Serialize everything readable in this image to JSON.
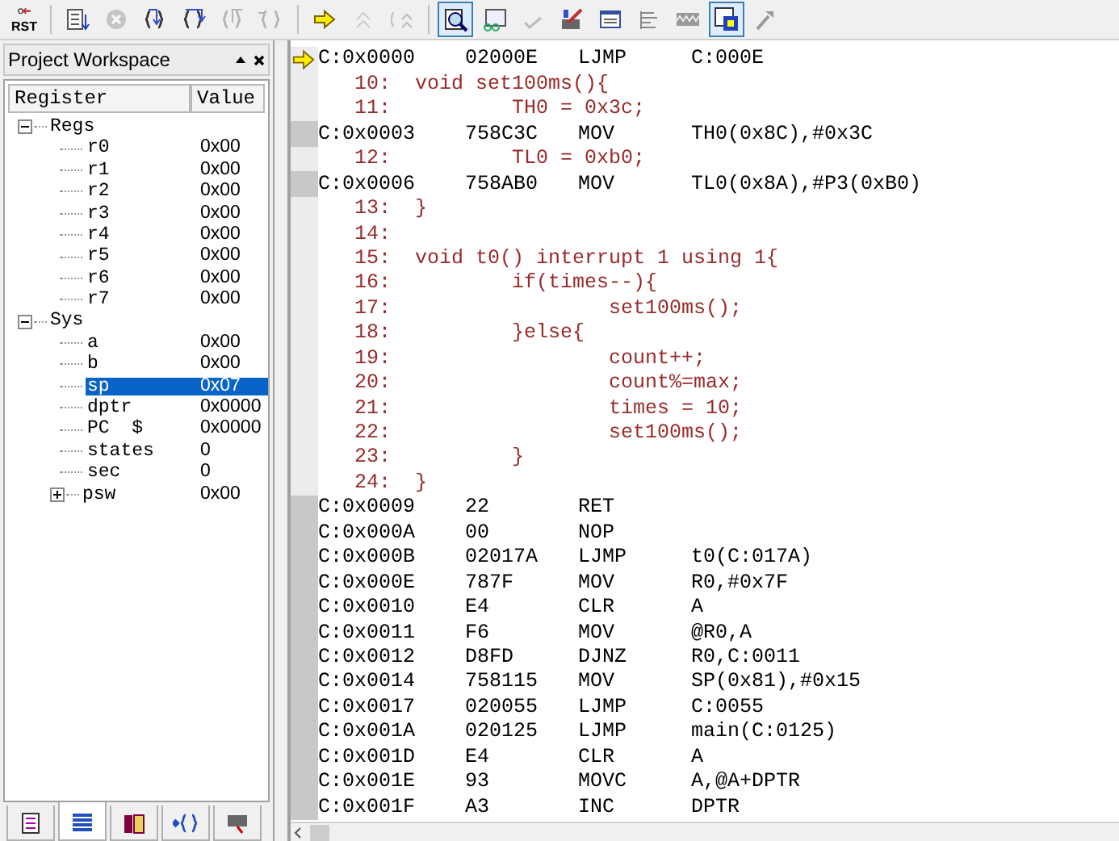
{
  "toolbar": [
    {
      "kind": "reset",
      "label": "RST",
      "disabled": false,
      "pressed": false
    },
    {
      "kind": "sep"
    },
    {
      "kind": "run",
      "disabled": false,
      "pressed": false
    },
    {
      "kind": "stop",
      "disabled": true,
      "pressed": false
    },
    {
      "kind": "step_into",
      "disabled": false,
      "pressed": false
    },
    {
      "kind": "step_over",
      "disabled": false,
      "pressed": false
    },
    {
      "kind": "step_out",
      "disabled": true,
      "pressed": false
    },
    {
      "kind": "run_to_cursor",
      "disabled": true,
      "pressed": false
    },
    {
      "kind": "sep"
    },
    {
      "kind": "show_next",
      "disabled": false,
      "pressed": false
    },
    {
      "kind": "trace",
      "disabled": true,
      "pressed": false
    },
    {
      "kind": "trace_view",
      "disabled": true,
      "pressed": false
    },
    {
      "kind": "sep"
    },
    {
      "kind": "disassembly",
      "disabled": false,
      "pressed": true
    },
    {
      "kind": "analyzer",
      "disabled": false,
      "pressed": false
    },
    {
      "kind": "coverage",
      "disabled": true,
      "pressed": false
    },
    {
      "kind": "serial",
      "disabled": false,
      "pressed": false
    },
    {
      "kind": "memory",
      "disabled": false,
      "pressed": false
    },
    {
      "kind": "performance",
      "disabled": false,
      "pressed": false
    },
    {
      "kind": "logic",
      "disabled": false,
      "pressed": false
    },
    {
      "kind": "symbols",
      "disabled": false,
      "pressed": true
    },
    {
      "kind": "tools",
      "disabled": false,
      "pressed": false
    }
  ],
  "workspace": {
    "title": "Project Workspace",
    "columns": [
      "Register",
      "Value"
    ],
    "tree": [
      {
        "name": "Regs",
        "expanded": true,
        "children": [
          {
            "name": "r0",
            "value": "0x00",
            "selected": false
          },
          {
            "name": "r1",
            "value": "0x00",
            "selected": false
          },
          {
            "name": "r2",
            "value": "0x00",
            "selected": false
          },
          {
            "name": "r3",
            "value": "0x00",
            "selected": false
          },
          {
            "name": "r4",
            "value": "0x00",
            "selected": false
          },
          {
            "name": "r5",
            "value": "0x00",
            "selected": false
          },
          {
            "name": "r6",
            "value": "0x00",
            "selected": false
          },
          {
            "name": "r7",
            "value": "0x00",
            "selected": false
          }
        ]
      },
      {
        "name": "Sys",
        "expanded": true,
        "children": [
          {
            "name": "a",
            "value": "0x00",
            "selected": false
          },
          {
            "name": "b",
            "value": "0x00",
            "selected": false
          },
          {
            "name": "sp",
            "value": "0x07",
            "selected": true
          },
          {
            "name": "dptr",
            "value": "0x0000",
            "selected": false
          },
          {
            "name": "PC  $",
            "value": "0x0000",
            "selected": false
          },
          {
            "name": "states",
            "value": "0",
            "selected": false
          },
          {
            "name": "sec",
            "value": "0",
            "selected": false
          },
          {
            "name": "psw",
            "value": "0x00",
            "selected": false,
            "expanded": false
          }
        ]
      }
    ],
    "tabs": [
      {
        "kind": "files",
        "selected": false
      },
      {
        "kind": "registers",
        "selected": true
      },
      {
        "kind": "books",
        "selected": false
      },
      {
        "kind": "functions",
        "selected": false
      },
      {
        "kind": "templates",
        "selected": false
      }
    ]
  },
  "disassembly": [
    {
      "kind": "asm",
      "current": true,
      "address": "C:0x0000",
      "bytes": "02000E",
      "mnemonic": "LJMP",
      "operand": "C:000E"
    },
    {
      "kind": "src",
      "number": "10:",
      "code": "void set100ms(){"
    },
    {
      "kind": "src",
      "number": "11:",
      "code": "        TH0 = 0x3c;"
    },
    {
      "kind": "asm",
      "current": false,
      "address": "C:0x0003",
      "bytes": "758C3C",
      "mnemonic": "MOV",
      "operand": "TH0(0x8C),#0x3C"
    },
    {
      "kind": "src",
      "number": "12:",
      "code": "        TL0 = 0xb0;"
    },
    {
      "kind": "asm",
      "current": false,
      "address": "C:0x0006",
      "bytes": "758AB0",
      "mnemonic": "MOV",
      "operand": "TL0(0x8A),#P3(0xB0)"
    },
    {
      "kind": "src",
      "number": "13:",
      "code": "}"
    },
    {
      "kind": "src",
      "number": "14:"
    },
    {
      "kind": "src",
      "number": "15:",
      "code": "void t0() interrupt 1 using 1{"
    },
    {
      "kind": "src",
      "number": "16:",
      "code": "        if(times--){"
    },
    {
      "kind": "src",
      "number": "17:",
      "code": "                set100ms();"
    },
    {
      "kind": "src",
      "number": "18:",
      "code": "        }else{"
    },
    {
      "kind": "src",
      "number": "19:",
      "code": "                count++;"
    },
    {
      "kind": "src",
      "number": "20:",
      "code": "                count%=max;"
    },
    {
      "kind": "src",
      "number": "21:",
      "code": "                times = 10;"
    },
    {
      "kind": "src",
      "number": "22:",
      "code": "                set100ms();"
    },
    {
      "kind": "src",
      "number": "23:",
      "code": "        }"
    },
    {
      "kind": "src",
      "number": "24:",
      "code": "}"
    },
    {
      "kind": "asm",
      "current": false,
      "address": "C:0x0009",
      "bytes": "22",
      "mnemonic": "RET"
    },
    {
      "kind": "asm",
      "current": false,
      "address": "C:0x000A",
      "bytes": "00",
      "mnemonic": "NOP"
    },
    {
      "kind": "asm",
      "current": false,
      "address": "C:0x000B",
      "bytes": "02017A",
      "mnemonic": "LJMP",
      "operand": "t0(C:017A)"
    },
    {
      "kind": "asm",
      "current": false,
      "address": "C:0x000E",
      "bytes": "787F",
      "mnemonic": "MOV",
      "operand": "R0,#0x7F"
    },
    {
      "kind": "asm",
      "current": false,
      "address": "C:0x0010",
      "bytes": "E4",
      "mnemonic": "CLR",
      "operand": "A"
    },
    {
      "kind": "asm",
      "current": false,
      "address": "C:0x0011",
      "bytes": "F6",
      "mnemonic": "MOV",
      "operand": "@R0,A"
    },
    {
      "kind": "asm",
      "current": false,
      "address": "C:0x0012",
      "bytes": "D8FD",
      "mnemonic": "DJNZ",
      "operand": "R0,C:0011"
    },
    {
      "kind": "asm",
      "current": false,
      "address": "C:0x0014",
      "bytes": "758115",
      "mnemonic": "MOV",
      "operand": "SP(0x81),#0x15"
    },
    {
      "kind": "asm",
      "current": false,
      "address": "C:0x0017",
      "bytes": "020055",
      "mnemonic": "LJMP",
      "operand": "C:0055"
    },
    {
      "kind": "asm",
      "current": false,
      "address": "C:0x001A",
      "bytes": "020125",
      "mnemonic": "LJMP",
      "operand": "main(C:0125)"
    },
    {
      "kind": "asm",
      "current": false,
      "address": "C:0x001D",
      "bytes": "E4",
      "mnemonic": "CLR",
      "operand": "A"
    },
    {
      "kind": "asm",
      "current": false,
      "address": "C:0x001E",
      "bytes": "93",
      "mnemonic": "MOVC",
      "operand": "A,@A+DPTR"
    },
    {
      "kind": "asm",
      "current": false,
      "address": "C:0x001F",
      "bytes": "A3",
      "mnemonic": "INC",
      "operand": "DPTR"
    }
  ]
}
